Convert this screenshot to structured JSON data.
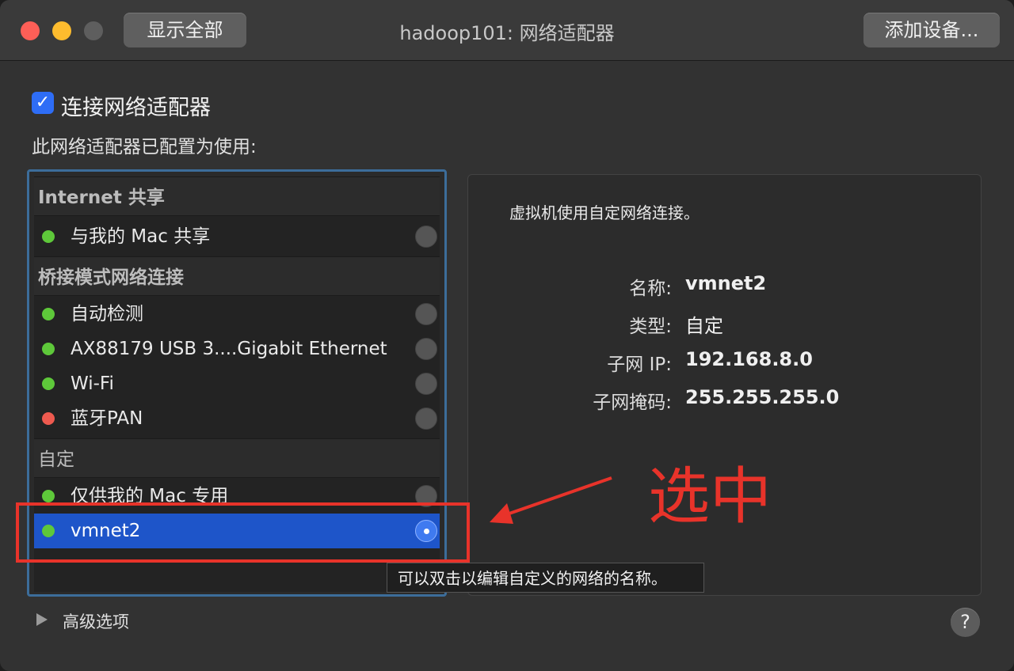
{
  "window": {
    "title": "hadoop101: 网络适配器",
    "show_all_label": "显示全部",
    "add_device_label": "添加设备..."
  },
  "connect": {
    "label": "连接网络适配器",
    "checked": true
  },
  "subtitle": "此网络适配器已配置为使用:",
  "groups": [
    {
      "header": "Internet 共享",
      "items": [
        {
          "label": "与我的 Mac 共享",
          "status": "green"
        }
      ]
    },
    {
      "header": "桥接模式网络连接",
      "items": [
        {
          "label": "自动检测",
          "status": "green"
        },
        {
          "label": "AX88179 USB 3....Gigabit Ethernet",
          "status": "green"
        },
        {
          "label": "Wi-Fi",
          "status": "green"
        },
        {
          "label": "蓝牙PAN",
          "status": "red"
        }
      ]
    },
    {
      "header": "自定",
      "items": [
        {
          "label": "仅供我的 Mac 专用",
          "status": "green"
        },
        {
          "label": "vmnet2",
          "status": "green",
          "selected": true
        }
      ]
    }
  ],
  "detail": {
    "description": "虚拟机使用自定网络连接。",
    "fields": [
      {
        "label": "名称:",
        "value": "vmnet2"
      },
      {
        "label": "类型:",
        "value": "自定"
      },
      {
        "label": "子网 IP:",
        "value": "192.168.8.0"
      },
      {
        "label": "子网掩码:",
        "value": "255.255.255.0"
      }
    ]
  },
  "advanced_label": "高级选项",
  "help_label": "?",
  "tooltip": "可以双击以编辑自定义的网络的名称。",
  "annotation": {
    "text": "选中",
    "color": "#e8332a"
  },
  "colors": {
    "accent": "#1e55c9",
    "status_green": "#5ec83a",
    "status_red": "#ee5a4f"
  }
}
